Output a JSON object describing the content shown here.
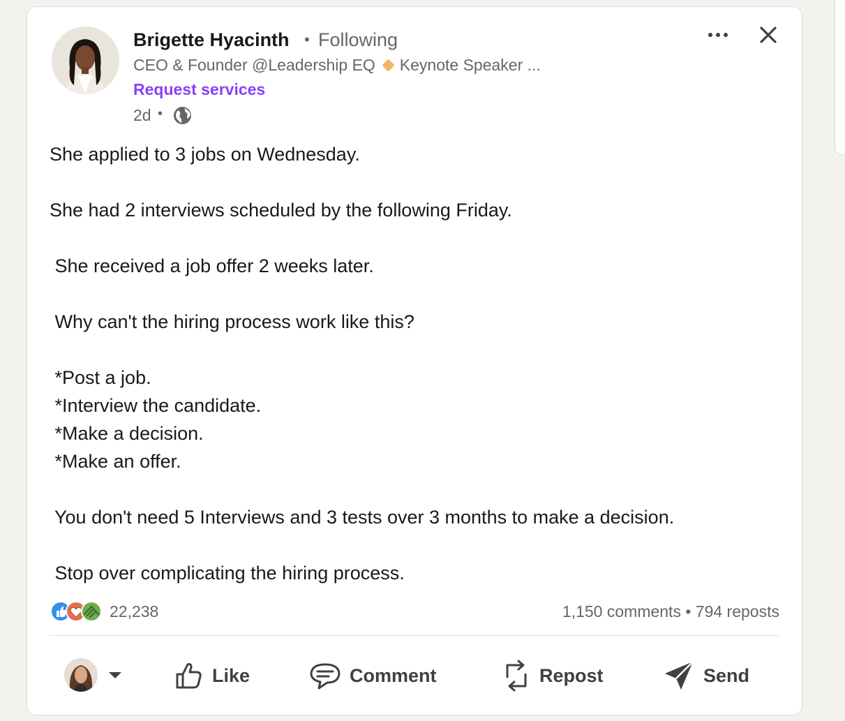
{
  "post": {
    "author": {
      "name": "Brigette Hyacinth",
      "following": "Following",
      "headline_part1": "CEO & Founder @Leadership EQ",
      "headline_part2": "Keynote Speaker ...",
      "request_services": "Request services",
      "time": "2d",
      "visibility_icon": "globe-icon"
    },
    "body": [
      "She applied to 3 jobs on Wednesday.",
      "She had 2 interviews scheduled by the following Friday.",
      " She received a job offer 2 weeks later.",
      " Why can't the hiring process work like this?",
      " *Post a job.",
      " *Interview the candidate.",
      " *Make a decision.",
      " *Make an offer.",
      " You don't need 5 Interviews and 3 tests over 3 months to make a decision.",
      " Stop over complicating the hiring process."
    ],
    "stats": {
      "reactions": "22,238",
      "comments": "1,150 comments",
      "reposts": "794 reposts"
    },
    "actions": {
      "like": "Like",
      "comment": "Comment",
      "repost": "Repost",
      "send": "Send"
    }
  },
  "colors": {
    "accent_purple": "#8a3ffc",
    "like_blue": "#378fe9",
    "love_red": "#df704d",
    "support_green": "#44712e",
    "text_secondary": "#666666",
    "background": "#f4f2ee"
  }
}
